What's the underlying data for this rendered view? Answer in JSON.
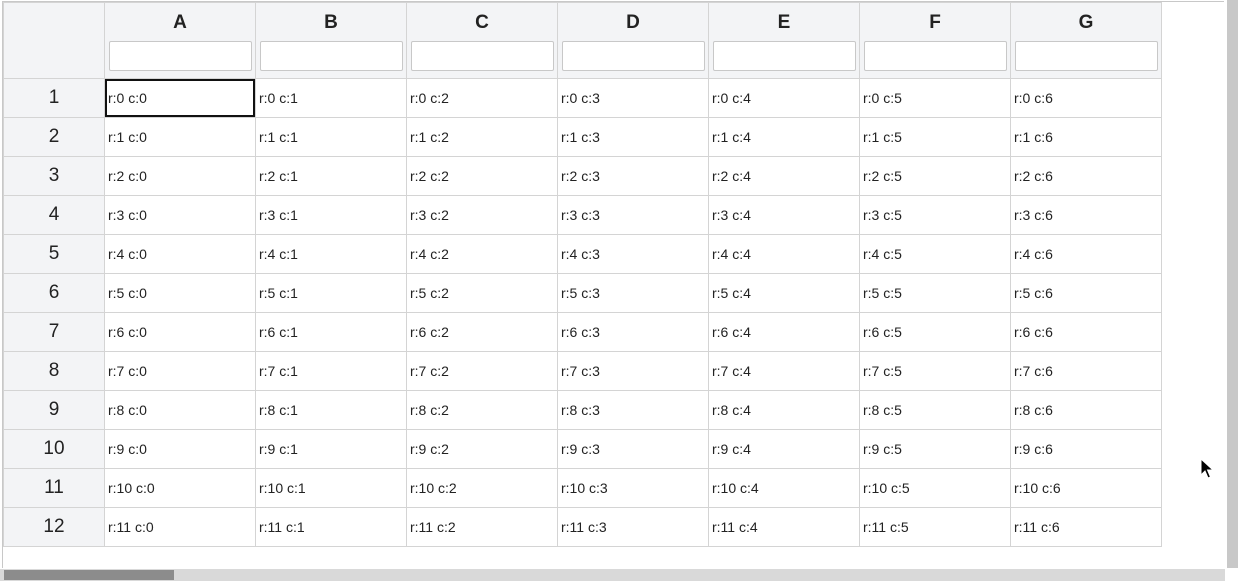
{
  "columns": [
    "A",
    "B",
    "C",
    "D",
    "E",
    "F",
    "G"
  ],
  "filters": [
    "",
    "",
    "",
    "",
    "",
    "",
    ""
  ],
  "active_cell": "r:0 c:0",
  "rows": [
    {
      "label": "1",
      "cells": [
        "r:0 c:0",
        "r:0 c:1",
        "r:0 c:2",
        "r:0 c:3",
        "r:0 c:4",
        "r:0 c:5",
        "r:0 c:6"
      ]
    },
    {
      "label": "2",
      "cells": [
        "r:1 c:0",
        "r:1 c:1",
        "r:1 c:2",
        "r:1 c:3",
        "r:1 c:4",
        "r:1 c:5",
        "r:1 c:6"
      ]
    },
    {
      "label": "3",
      "cells": [
        "r:2 c:0",
        "r:2 c:1",
        "r:2 c:2",
        "r:2 c:3",
        "r:2 c:4",
        "r:2 c:5",
        "r:2 c:6"
      ]
    },
    {
      "label": "4",
      "cells": [
        "r:3 c:0",
        "r:3 c:1",
        "r:3 c:2",
        "r:3 c:3",
        "r:3 c:4",
        "r:3 c:5",
        "r:3 c:6"
      ]
    },
    {
      "label": "5",
      "cells": [
        "r:4 c:0",
        "r:4 c:1",
        "r:4 c:2",
        "r:4 c:3",
        "r:4 c:4",
        "r:4 c:5",
        "r:4 c:6"
      ]
    },
    {
      "label": "6",
      "cells": [
        "r:5 c:0",
        "r:5 c:1",
        "r:5 c:2",
        "r:5 c:3",
        "r:5 c:4",
        "r:5 c:5",
        "r:5 c:6"
      ]
    },
    {
      "label": "7",
      "cells": [
        "r:6 c:0",
        "r:6 c:1",
        "r:6 c:2",
        "r:6 c:3",
        "r:6 c:4",
        "r:6 c:5",
        "r:6 c:6"
      ]
    },
    {
      "label": "8",
      "cells": [
        "r:7 c:0",
        "r:7 c:1",
        "r:7 c:2",
        "r:7 c:3",
        "r:7 c:4",
        "r:7 c:5",
        "r:7 c:6"
      ]
    },
    {
      "label": "9",
      "cells": [
        "r:8 c:0",
        "r:8 c:1",
        "r:8 c:2",
        "r:8 c:3",
        "r:8 c:4",
        "r:8 c:5",
        "r:8 c:6"
      ]
    },
    {
      "label": "10",
      "cells": [
        "r:9 c:0",
        "r:9 c:1",
        "r:9 c:2",
        "r:9 c:3",
        "r:9 c:4",
        "r:9 c:5",
        "r:9 c:6"
      ]
    },
    {
      "label": "11",
      "cells": [
        "r:10 c:0",
        "r:10 c:1",
        "r:10 c:2",
        "r:10 c:3",
        "r:10 c:4",
        "r:10 c:5",
        "r:10 c:6"
      ]
    },
    {
      "label": "12",
      "cells": [
        "r:11 c:0",
        "r:11 c:1",
        "r:11 c:2",
        "r:11 c:3",
        "r:11 c:4",
        "r:11 c:5",
        "r:11 c:6"
      ]
    }
  ],
  "scroll": {
    "horizontal_fraction_visible": 0.14,
    "horizontal_position": 0.0
  },
  "colors": {
    "header_bg": "#f3f4f6",
    "grid_line": "#d4d4d4",
    "active_border": "#111111",
    "scroll_thumb": "#8c8c8c"
  },
  "icons": {
    "pointer": "mouse-pointer-icon"
  }
}
